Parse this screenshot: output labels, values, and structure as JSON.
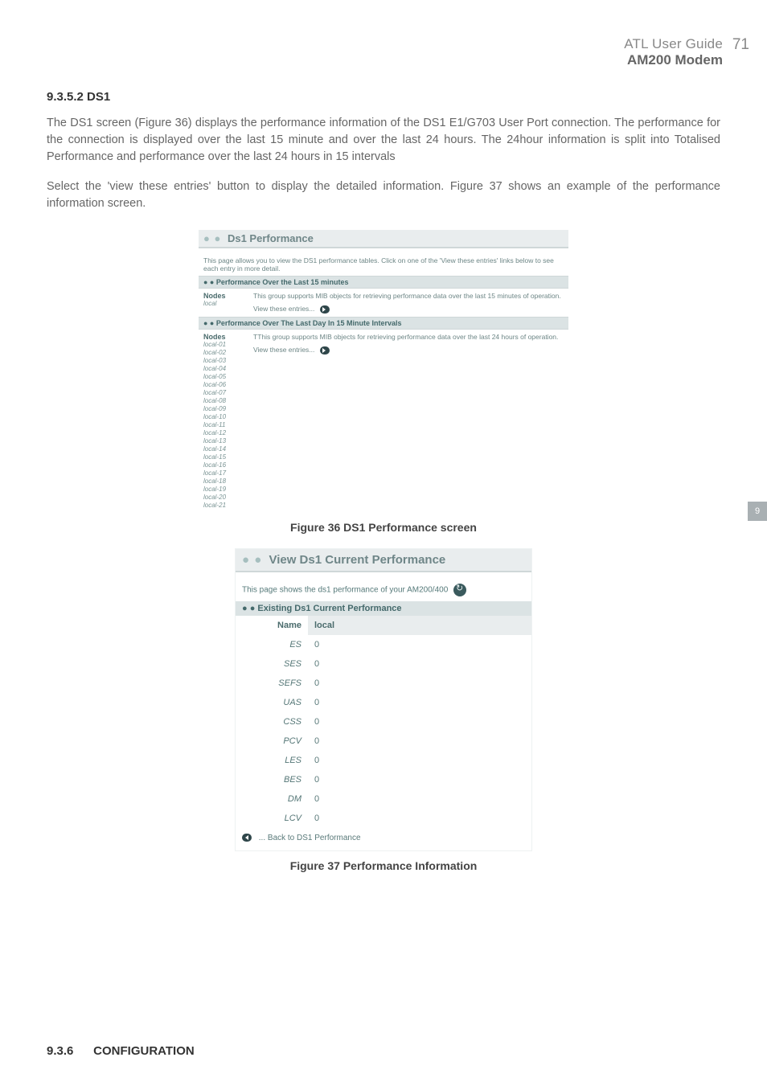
{
  "header": {
    "manual_title": "ATL User Guide",
    "page_number": "71",
    "model": "AM200 Modem"
  },
  "side_tab": "9",
  "section1": {
    "number": "9.3.5.2",
    "title": "DS1",
    "para1": "The DS1 screen (Figure 36) displays the performance information of the DS1 E1/G703 User Port connection. The performance for the connection is displayed over the last 15 minute and over the last 24 hours. The 24hour information is split into Totalised Performance and performance over the last 24 hours in 15 intervals",
    "para2": "Select the 'view these entries' button to display the detailed information. Figure 37 shows an example of the performance information screen."
  },
  "fig36": {
    "caption": "Figure 36 DS1 Performance screen",
    "title": "Ds1 Performance",
    "intro": "This page allows you to view the DS1 performance tables. Click on one of the 'View these entries' links below to see each entry in more detail.",
    "panel_a": {
      "bar": "Performance Over the Last 15 minutes",
      "nodes_hdr": "Nodes",
      "nodes": [
        "local"
      ],
      "desc": "This group supports MIB objects for retrieving performance data over the last 15 minutes of operation.",
      "view": "View these entries..."
    },
    "panel_b": {
      "bar": "Performance Over The Last Day In 15 Minute Intervals",
      "nodes_hdr": "Nodes",
      "nodes": [
        "local-01",
        "local-02",
        "local-03",
        "local-04",
        "local-05",
        "local-06",
        "local-07",
        "local-08",
        "local-09",
        "local-10",
        "local-11",
        "local-12",
        "local-13",
        "local-14",
        "local-15",
        "local-16",
        "local-17",
        "local-18",
        "local-19",
        "local-20",
        "local-21"
      ],
      "desc": "TThis group supports MIB objects for retrieving performance data over the last 24 hours of operation.",
      "view": "View these entries..."
    }
  },
  "fig37": {
    "caption": "Figure 37 Performance Information",
    "title": "View Ds1 Current Performance",
    "intro": "This page shows the ds1 performance of your AM200/400",
    "sect_bar": "Existing Ds1 Current Performance",
    "name_label": "Name",
    "name_value": "local",
    "rows": [
      {
        "label": "ES",
        "value": "0"
      },
      {
        "label": "SES",
        "value": "0"
      },
      {
        "label": "SEFS",
        "value": "0"
      },
      {
        "label": "UAS",
        "value": "0"
      },
      {
        "label": "CSS",
        "value": "0"
      },
      {
        "label": "PCV",
        "value": "0"
      },
      {
        "label": "LES",
        "value": "0"
      },
      {
        "label": "BES",
        "value": "0"
      },
      {
        "label": "DM",
        "value": "0"
      },
      {
        "label": "LCV",
        "value": "0"
      }
    ],
    "back": "... Back to DS1 Performance"
  },
  "section2": {
    "number": "9.3.6",
    "title": "CONFIGURATION"
  }
}
